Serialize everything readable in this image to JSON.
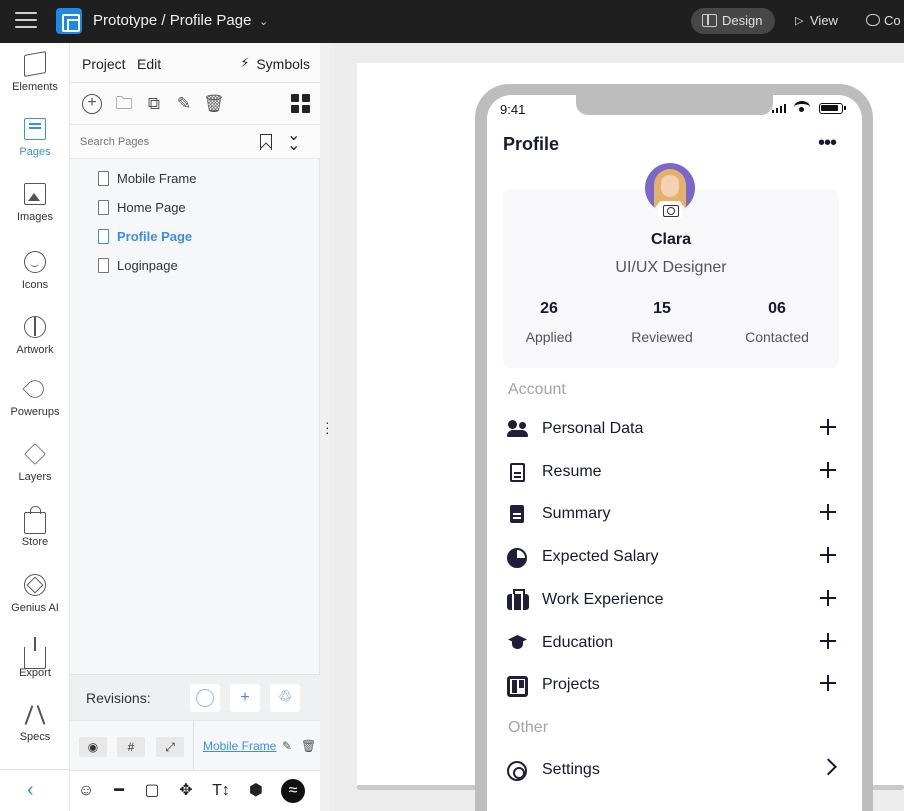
{
  "topbar": {
    "breadcrumb": "Prototype / Profile Page",
    "design_label": "Design",
    "view_label": "View",
    "comment_label": "Co"
  },
  "rail": {
    "items": [
      {
        "label": "Elements",
        "icon": "cube-icon"
      },
      {
        "label": "Pages",
        "icon": "pages-icon"
      },
      {
        "label": "Images",
        "icon": "image-icon"
      },
      {
        "label": "Icons",
        "icon": "smiley-icon"
      },
      {
        "label": "Artwork",
        "icon": "basketball-icon"
      },
      {
        "label": "Powerups",
        "icon": "rocket-icon"
      },
      {
        "label": "Layers",
        "icon": "layers-icon"
      },
      {
        "label": "Store",
        "icon": "shopping-bag-icon"
      },
      {
        "label": "Genius AI",
        "icon": "ai-hexagon-icon"
      },
      {
        "label": "Export",
        "icon": "export-icon"
      },
      {
        "label": "Specs",
        "icon": "compass-icon"
      }
    ],
    "active_index": 1
  },
  "panel": {
    "tabs": {
      "project": "Project",
      "edit": "Edit",
      "symbols": "Symbols"
    },
    "search_placeholder": "Search Pages",
    "pages": [
      {
        "label": "Mobile Frame",
        "active": false
      },
      {
        "label": "Home Page",
        "active": false
      },
      {
        "label": "Profile Page",
        "active": true
      },
      {
        "label": "Loginpage",
        "active": false
      }
    ],
    "revisions_label": "Revisions:",
    "frame_link": "Mobile Frame"
  },
  "phone": {
    "time": "9:41",
    "title": "Profile",
    "name": "Clara",
    "role": "UI/UX Designer",
    "stats": [
      {
        "value": "26",
        "label": "Applied"
      },
      {
        "value": "15",
        "label": "Reviewed"
      },
      {
        "value": "06",
        "label": "Contacted"
      }
    ],
    "account_heading": "Account",
    "account_items": [
      {
        "label": "Personal Data",
        "icon": "users-icon"
      },
      {
        "label": "Resume",
        "icon": "document-icon"
      },
      {
        "label": "Summary",
        "icon": "document-filled-icon"
      },
      {
        "label": "Expected Salary",
        "icon": "pie-chart-icon"
      },
      {
        "label": "Work Experience",
        "icon": "briefcase-icon"
      },
      {
        "label": "Education",
        "icon": "graduation-cap-icon"
      },
      {
        "label": "Projects",
        "icon": "board-icon"
      }
    ],
    "other_heading": "Other",
    "other_items": [
      {
        "label": "Settings",
        "icon": "gear-icon"
      }
    ]
  },
  "colors": {
    "accent": "#3a8ee6",
    "dark_navy": "#171738",
    "topbar_bg": "#1f1f1f"
  }
}
